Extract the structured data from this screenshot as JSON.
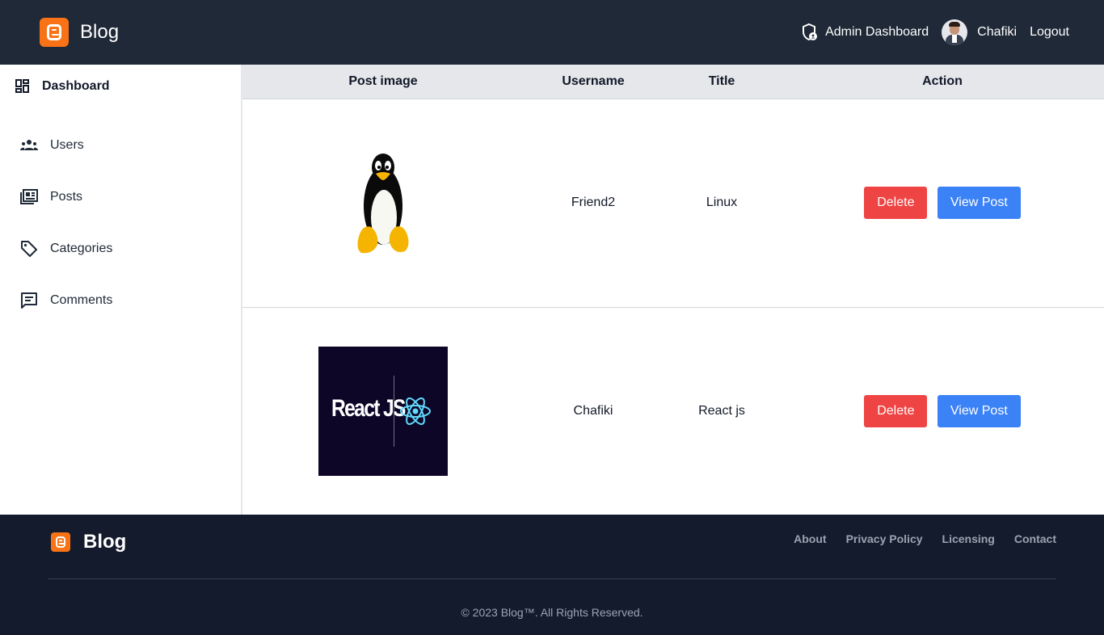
{
  "header": {
    "brand": "Blog",
    "admin_link": "Admin Dashboard",
    "username": "Chafiki",
    "logout": "Logout"
  },
  "sidebar": {
    "dashboard": "Dashboard",
    "items": [
      {
        "label": "Users",
        "icon": "users-icon"
      },
      {
        "label": "Posts",
        "icon": "posts-icon"
      },
      {
        "label": "Categories",
        "icon": "tag-icon"
      },
      {
        "label": "Comments",
        "icon": "comment-icon"
      }
    ]
  },
  "table": {
    "headers": [
      "Post image",
      "Username",
      "Title",
      "Action"
    ],
    "rows": [
      {
        "image": "linux-penguin",
        "username": "Friend2",
        "title": "Linux",
        "delete": "Delete",
        "view": "View Post"
      },
      {
        "image": "react-logo",
        "image_text": "React JS",
        "username": "Chafiki",
        "title": "React js",
        "delete": "Delete",
        "view": "View Post"
      }
    ]
  },
  "footer": {
    "brand": "Blog",
    "links": [
      "About",
      "Privacy Policy",
      "Licensing",
      "Contact"
    ],
    "copyright": "© 2023 Blog™. All Rights Reserved."
  },
  "colors": {
    "header_bg": "#1f2937",
    "footer_bg": "#141b2d",
    "brand_orange": "#f97316",
    "delete_red": "#ef4444",
    "view_blue": "#3b82f6"
  }
}
